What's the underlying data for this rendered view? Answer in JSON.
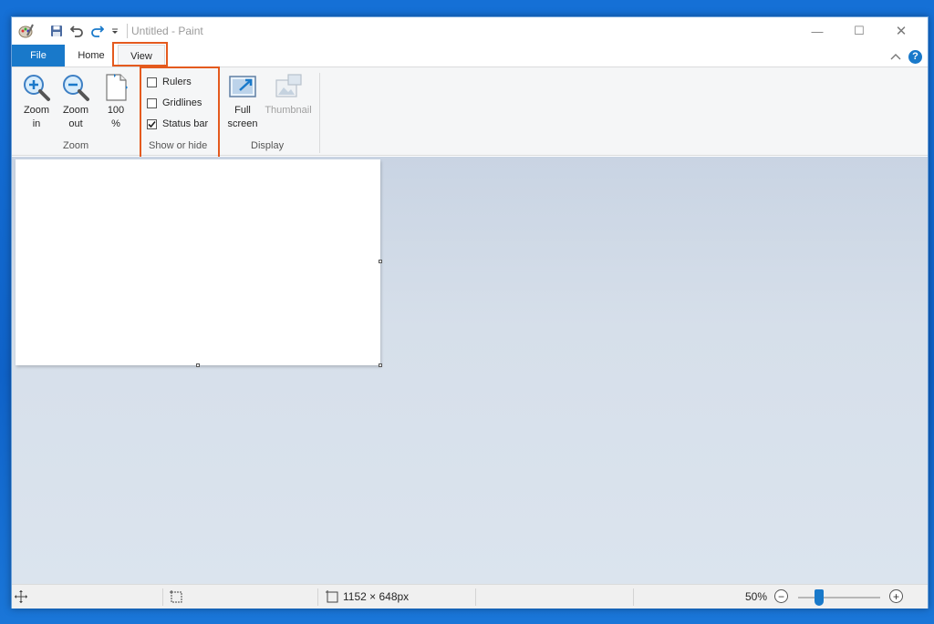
{
  "window": {
    "title": "Untitled - Paint",
    "controls": {
      "minimize": "—",
      "maximize": "☐",
      "close": "✕"
    }
  },
  "tabs": [
    {
      "label": "File"
    },
    {
      "label": "Home"
    },
    {
      "label": "View"
    }
  ],
  "ribbon": {
    "zoom_group": {
      "label": "Zoom",
      "zoom_in_line1": "Zoom",
      "zoom_in_line2": "in",
      "zoom_out_line1": "Zoom",
      "zoom_out_line2": "out",
      "hundred_line1": "100",
      "hundred_line2": "%"
    },
    "show_hide_group": {
      "label": "Show or hide",
      "rulers": {
        "label": "Rulers",
        "checked": false
      },
      "gridlines": {
        "label": "Gridlines",
        "checked": false
      },
      "status_bar": {
        "label": "Status bar",
        "checked": true
      }
    },
    "display_group": {
      "label": "Display",
      "full_screen_line1": "Full",
      "full_screen_line2": "screen",
      "thumbnail": "Thumbnail"
    }
  },
  "status_bar": {
    "image_size": "1152 × 648px",
    "zoom_level": "50%",
    "zoom_minus": "−",
    "zoom_plus": "+"
  },
  "colors": {
    "accent": "#1979ca",
    "highlight": "#e45a1e",
    "desktop": "#1570d6"
  }
}
